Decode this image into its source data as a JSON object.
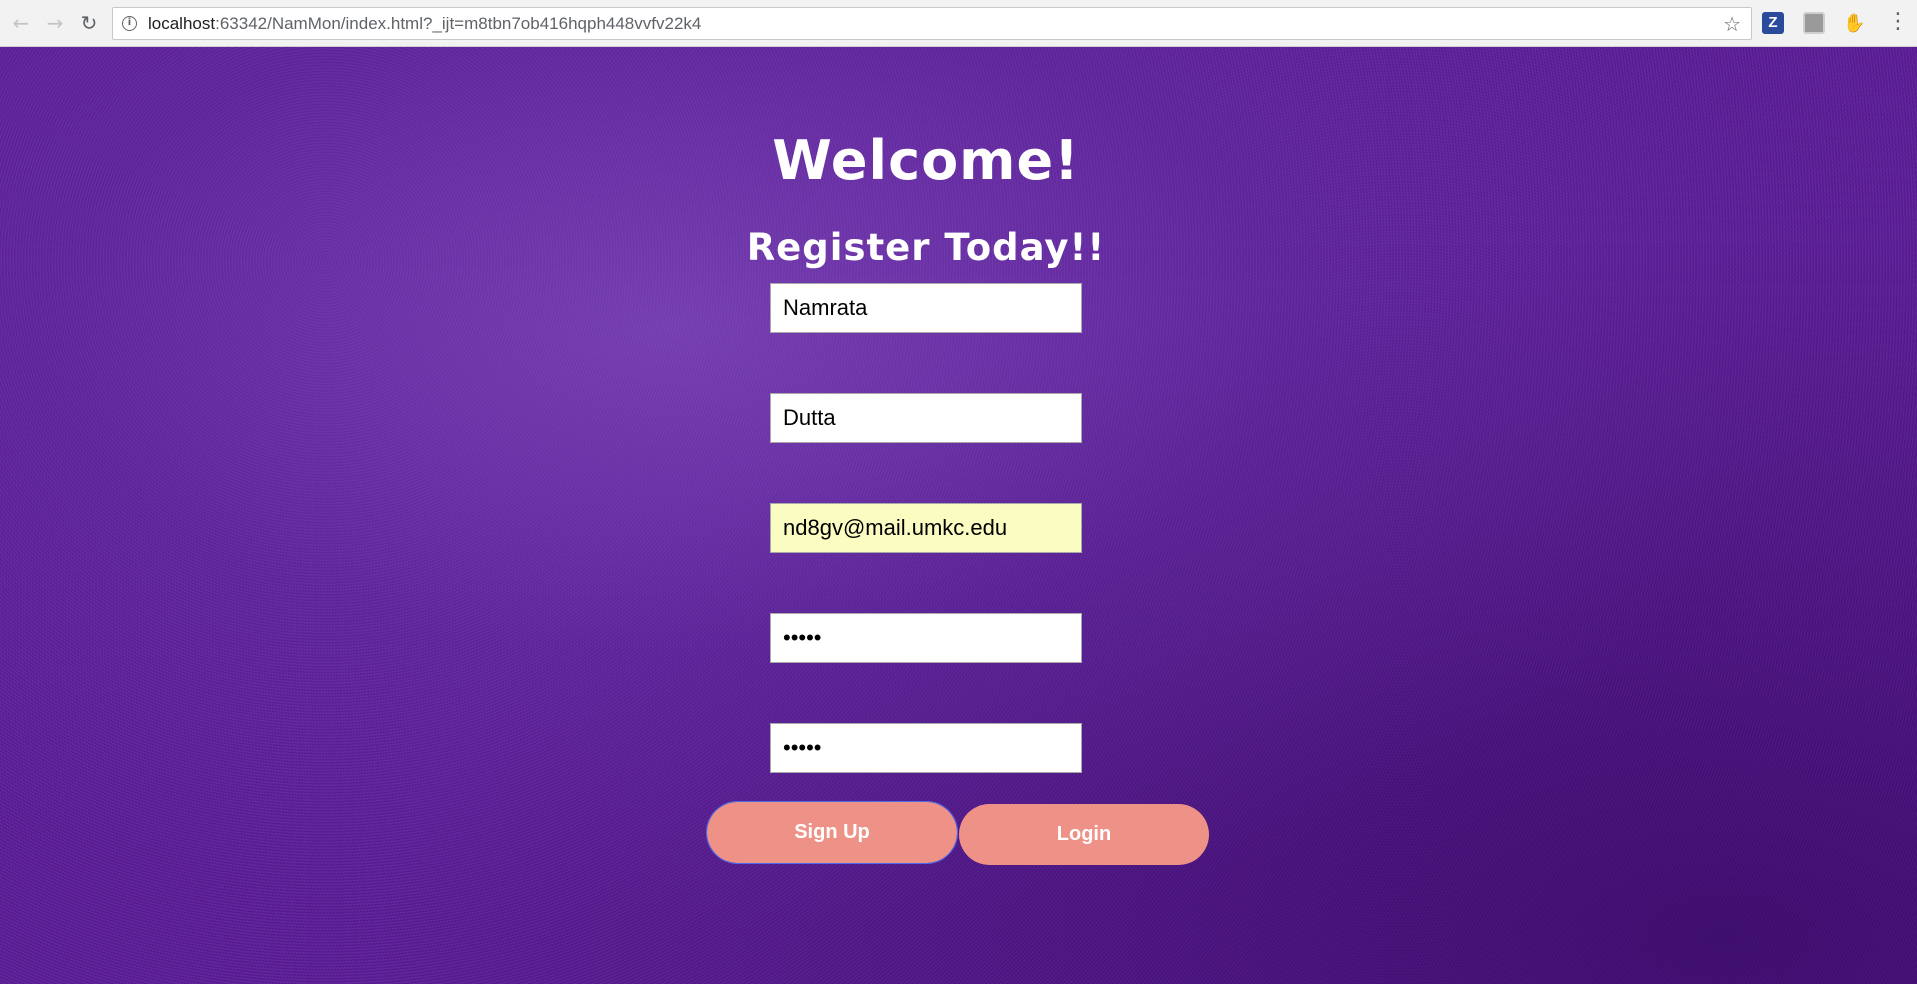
{
  "browser": {
    "url_host": "localhost",
    "url_rest": ":63342/NamMon/index.html?_ijt=m8tbn7ob416hqph448vvfv22k4"
  },
  "page": {
    "welcome": "Welcome!",
    "register": "Register Today!!"
  },
  "form": {
    "first_name": "Namrata",
    "last_name": "Dutta",
    "email": "nd8gv@mail.umkc.edu",
    "password": "•••••",
    "confirm_password": "•••••"
  },
  "buttons": {
    "signup": "Sign Up",
    "login": "Login"
  },
  "colors": {
    "background": "#5a1a96",
    "button": "#ee9288",
    "autofill": "#fafcc2"
  },
  "icons": [
    "back-arrow-icon",
    "forward-arrow-icon",
    "reload-icon",
    "info-icon",
    "star-icon",
    "zotero-extension-icon",
    "extension-icon",
    "extension-hand-icon",
    "menu-icon"
  ]
}
